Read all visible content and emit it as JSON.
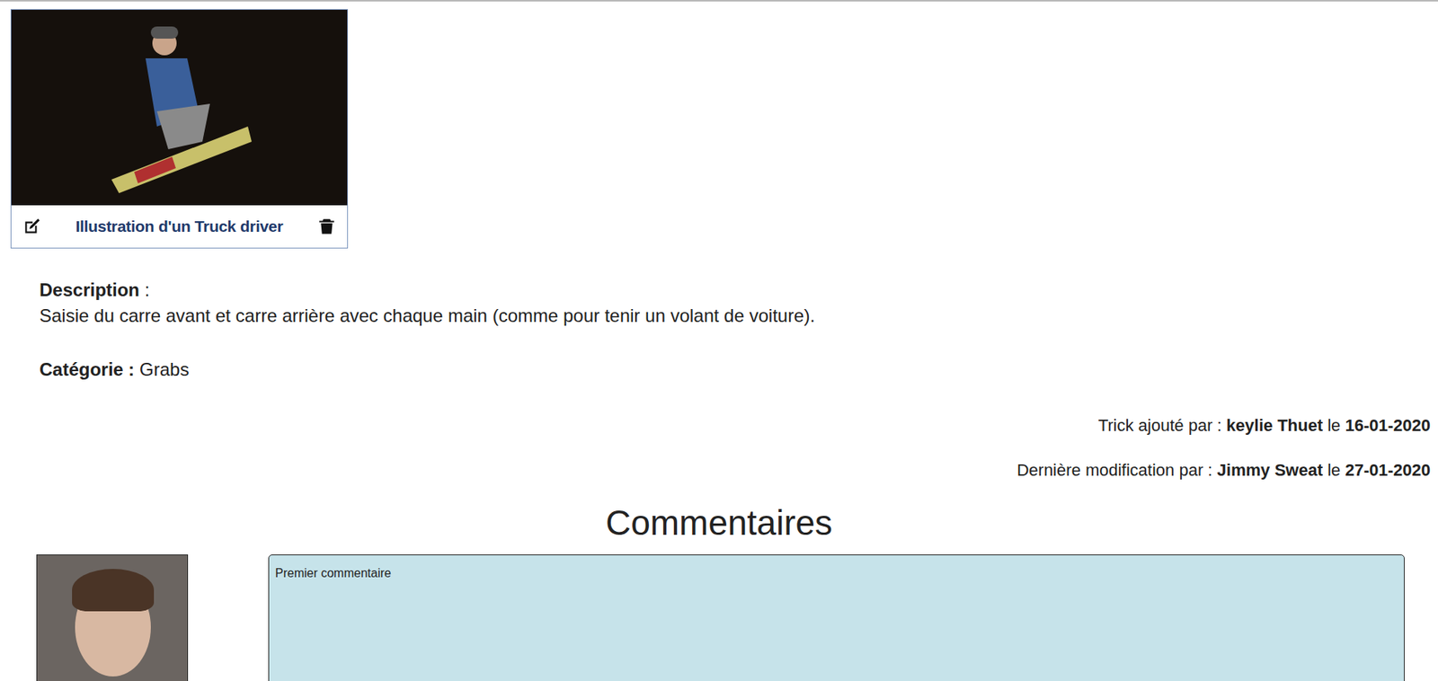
{
  "media": [
    {
      "caption": "Illustration d'un Truck driver"
    }
  ],
  "description": {
    "label": "Description",
    "separator": ":",
    "text": "Saisie du carre avant et carre arrière avec chaque main (comme pour tenir un volant de voiture)."
  },
  "category": {
    "label": "Catégorie :",
    "value": "Grabs"
  },
  "meta": [
    {
      "prefix": "Trick ajouté par :",
      "author": "keylie Thuet",
      "joiner": "le",
      "date": "16-01-2020"
    },
    {
      "prefix": "Dernière modification par :",
      "author": "Jimmy Sweat",
      "joiner": "le",
      "date": "27-01-2020"
    }
  ],
  "comments_title": "Commentaires",
  "comments": [
    {
      "text": "Premier commentaire"
    }
  ]
}
